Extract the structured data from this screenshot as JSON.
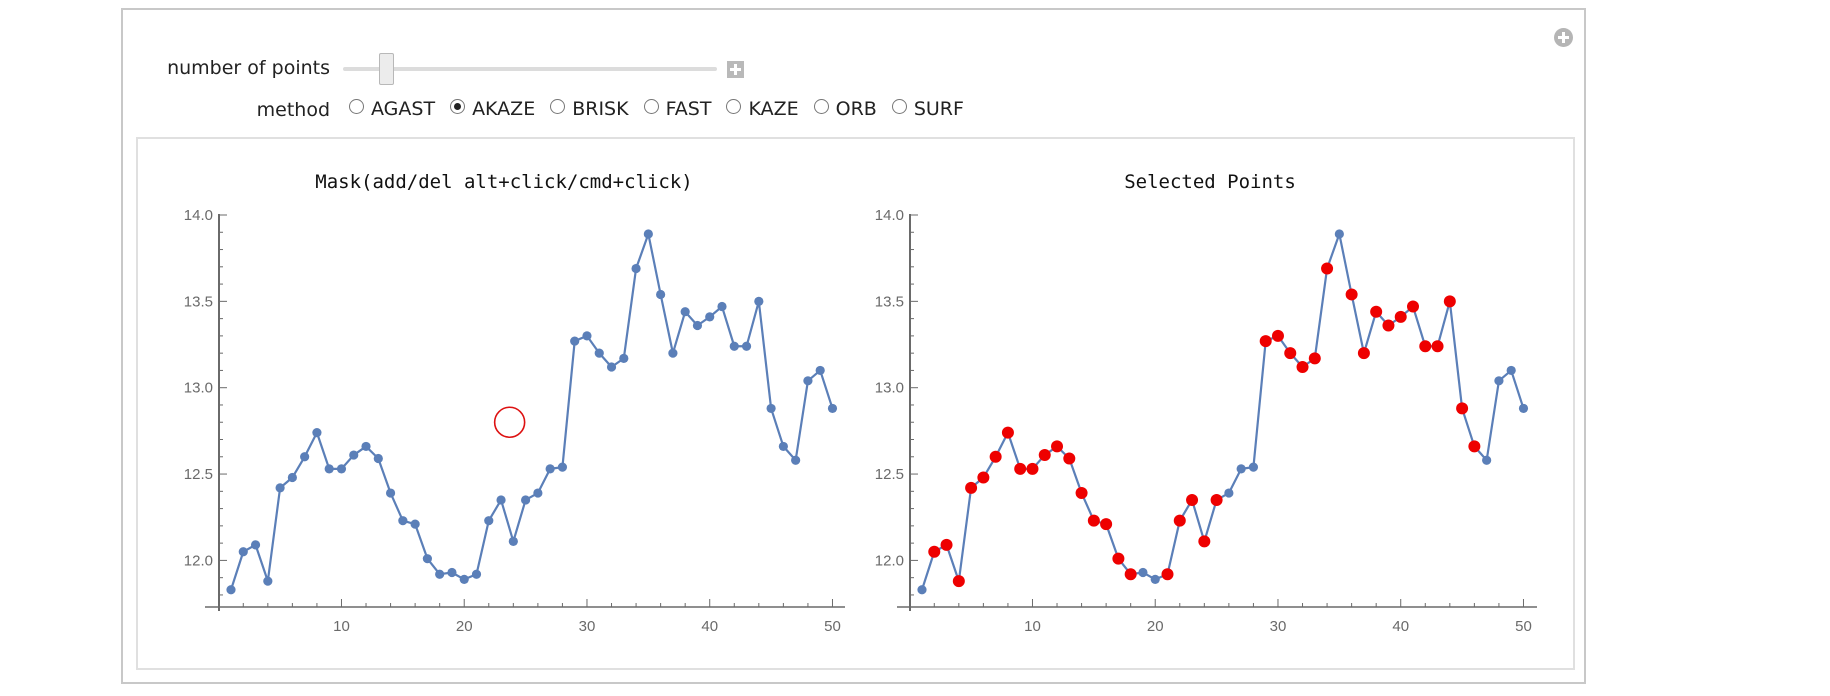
{
  "controls": {
    "number_of_points": {
      "label": "number of points",
      "slider_fraction": 0.115
    },
    "method": {
      "label": "method",
      "options": [
        "AGAST",
        "AKAZE",
        "BRISK",
        "FAST",
        "KAZE",
        "ORB",
        "SURF"
      ],
      "selected": "AKAZE"
    }
  },
  "icons": {
    "panel_expand": "plus-circle-icon",
    "slider_expand": "plus-square-icon"
  },
  "colors": {
    "series": "#5b7fb8",
    "selected": "#ee0000",
    "mask_circle": "#dd1111",
    "axis": "#6a6a6a"
  },
  "chart_data": [
    {
      "type": "line",
      "title": "Mask(add/del alt+click/cmd+click)",
      "xlabel": "",
      "ylabel": "",
      "xlim": [
        0,
        51
      ],
      "ylim": [
        11.77,
        14.0
      ],
      "xticks": [
        10,
        20,
        30,
        40,
        50
      ],
      "yticks": [
        12.0,
        12.5,
        13.0,
        13.5,
        14.0
      ],
      "ytick_labels": [
        "12.0",
        "12.5",
        "13.0",
        "13.5",
        "14.0"
      ],
      "grid": false,
      "x": [
        1,
        2,
        3,
        4,
        5,
        6,
        7,
        8,
        9,
        10,
        11,
        12,
        13,
        14,
        15,
        16,
        17,
        18,
        19,
        20,
        21,
        22,
        23,
        24,
        25,
        26,
        27,
        28,
        29,
        30,
        31,
        32,
        33,
        34,
        35,
        36,
        37,
        38,
        39,
        40,
        41,
        42,
        43,
        44,
        45,
        46,
        47,
        48,
        49,
        50
      ],
      "y": [
        11.83,
        12.05,
        12.09,
        11.88,
        12.42,
        12.48,
        12.6,
        12.74,
        12.53,
        12.53,
        12.61,
        12.66,
        12.59,
        12.39,
        12.23,
        12.21,
        12.01,
        11.92,
        11.93,
        11.89,
        11.92,
        12.23,
        12.35,
        12.11,
        12.35,
        12.39,
        12.53,
        12.54,
        13.27,
        13.3,
        13.2,
        13.12,
        13.17,
        13.69,
        13.89,
        13.54,
        13.2,
        13.44,
        13.36,
        13.41,
        13.47,
        13.24,
        13.24,
        13.5,
        12.88,
        12.66,
        12.58,
        13.04,
        13.1,
        12.88
      ],
      "mask_circles": [
        {
          "x": 23.7,
          "y": 12.8
        }
      ]
    },
    {
      "type": "line",
      "title": "Selected Points",
      "xlabel": "",
      "ylabel": "",
      "xlim": [
        0,
        51
      ],
      "ylim": [
        11.77,
        14.0
      ],
      "xticks": [
        10,
        20,
        30,
        40,
        50
      ],
      "yticks": [
        12.0,
        12.5,
        13.0,
        13.5,
        14.0
      ],
      "ytick_labels": [
        "12.0",
        "12.5",
        "13.0",
        "13.5",
        "14.0"
      ],
      "grid": false,
      "x": [
        1,
        2,
        3,
        4,
        5,
        6,
        7,
        8,
        9,
        10,
        11,
        12,
        13,
        14,
        15,
        16,
        17,
        18,
        19,
        20,
        21,
        22,
        23,
        24,
        25,
        26,
        27,
        28,
        29,
        30,
        31,
        32,
        33,
        34,
        35,
        36,
        37,
        38,
        39,
        40,
        41,
        42,
        43,
        44,
        45,
        46,
        47,
        48,
        49,
        50
      ],
      "y": [
        11.83,
        12.05,
        12.09,
        11.88,
        12.42,
        12.48,
        12.6,
        12.74,
        12.53,
        12.53,
        12.61,
        12.66,
        12.59,
        12.39,
        12.23,
        12.21,
        12.01,
        11.92,
        11.93,
        11.89,
        11.92,
        12.23,
        12.35,
        12.11,
        12.35,
        12.39,
        12.53,
        12.54,
        13.27,
        13.3,
        13.2,
        13.12,
        13.17,
        13.69,
        13.89,
        13.54,
        13.2,
        13.44,
        13.36,
        13.41,
        13.47,
        13.24,
        13.24,
        13.5,
        12.88,
        12.66,
        12.58,
        13.04,
        13.1,
        12.88
      ],
      "selected_x": [
        2,
        3,
        4,
        5,
        6,
        7,
        8,
        9,
        10,
        11,
        12,
        13,
        14,
        15,
        16,
        17,
        18,
        21,
        22,
        23,
        24,
        25,
        29,
        30,
        31,
        32,
        33,
        34,
        36,
        37,
        38,
        39,
        40,
        41,
        42,
        43,
        44,
        45,
        46
      ]
    }
  ]
}
